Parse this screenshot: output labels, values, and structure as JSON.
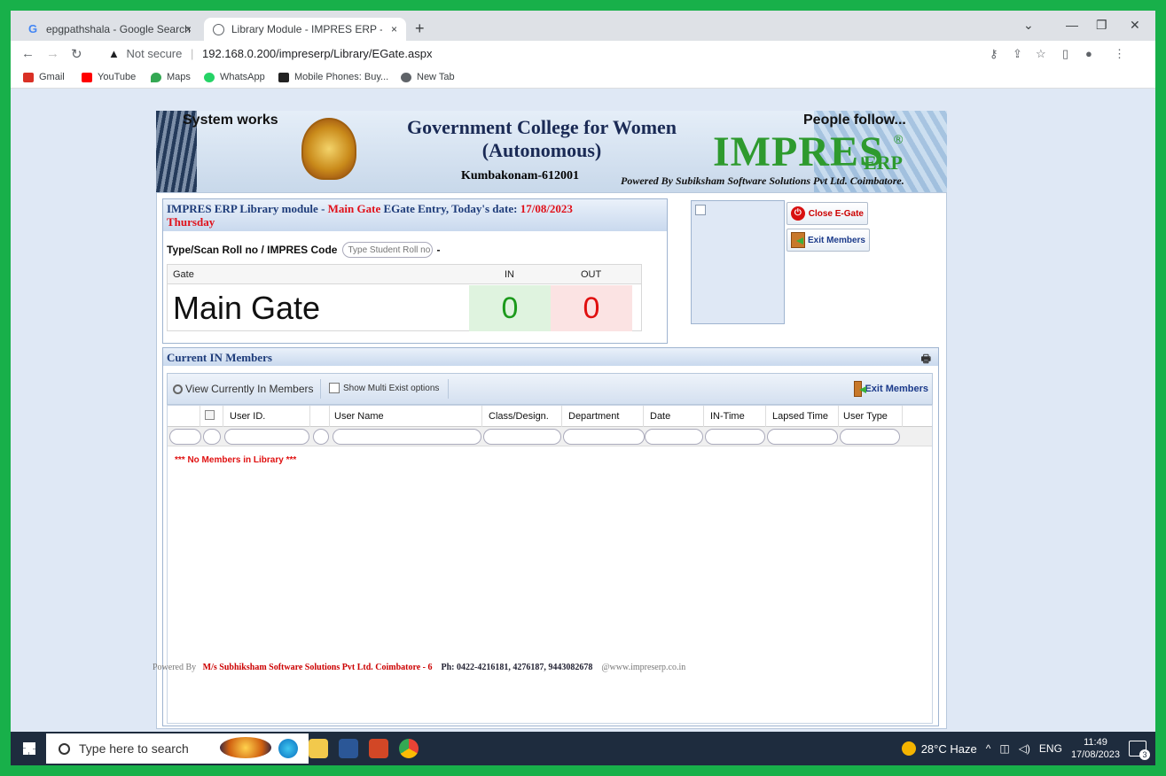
{
  "browser": {
    "tabs": [
      {
        "title": "epgpathshala - Google Search"
      },
      {
        "title": "Library Module - IMPRES ERP - P"
      }
    ],
    "new_tab_symbol": "+",
    "close_symbol": "×",
    "url_prefix": "Not secure",
    "url": "192.168.0.200/impreserp/Library/EGate.aspx",
    "bookmarks": [
      {
        "label": "Gmail",
        "color": "#d93025"
      },
      {
        "label": "YouTube",
        "color": "#ff0000"
      },
      {
        "label": "Maps",
        "color": "#34a853"
      },
      {
        "label": "WhatsApp",
        "color": "#25d366"
      },
      {
        "label": "Mobile Phones: Buy...",
        "color": "#222222"
      },
      {
        "label": "New Tab",
        "color": "#5f6368"
      }
    ]
  },
  "banner": {
    "system_works": "System works",
    "college_line1": "Government College for Women",
    "college_line2": "(Autonomous)",
    "place": "Kumbakonam-612001",
    "people_follow": "People follow...",
    "brand": "IMPRES",
    "brand_sub": "ERP",
    "registered": "®",
    "powered_by": "Powered By Subiksham Software Solutions Pvt Ltd. Coimbatore."
  },
  "egate": {
    "head_prefix": "IMPRES ERP Library module - ",
    "head_gate": "Main Gate",
    "head_mid": " EGate Entry, Today's date: ",
    "head_date": "17/08/2023",
    "head_day": "Thursday",
    "scan_label": "Type/Scan Roll no / IMPRES Code",
    "scan_placeholder": "Type Student Roll no",
    "scan_dash": "-",
    "table": {
      "col_gate": "Gate",
      "col_in": "IN",
      "col_out": "OUT",
      "gate_name": "Main Gate",
      "in_count": "0",
      "out_count": "0"
    },
    "close_label": "Close E-Gate",
    "exit_label": "Exit Members"
  },
  "current": {
    "title": "Current IN Members",
    "view_label": "View Currently In Members",
    "multi_label": "Show Multi Exist options",
    "exit_label": "Exit Members",
    "columns": [
      "User ID.",
      "User Name",
      "Class/Design.",
      "Department",
      "Date",
      "IN-Time",
      "Lapsed Time",
      "User Type"
    ],
    "empty_message": "*** No Members in Library ***"
  },
  "footer": {
    "powered": "Powered By",
    "company": "M/s Subhiksham Software Solutions Pvt Ltd. Coimbatore - 6",
    "phone": "Ph: 0422-4216181, 4276187, 9443082678",
    "web": "@www.impreserp.co.in"
  },
  "taskbar": {
    "search_placeholder": "Type here to search",
    "weather": "28°C  Haze",
    "lang": "ENG",
    "time": "11:49",
    "date": "17/08/2023",
    "notif_count": "3"
  }
}
